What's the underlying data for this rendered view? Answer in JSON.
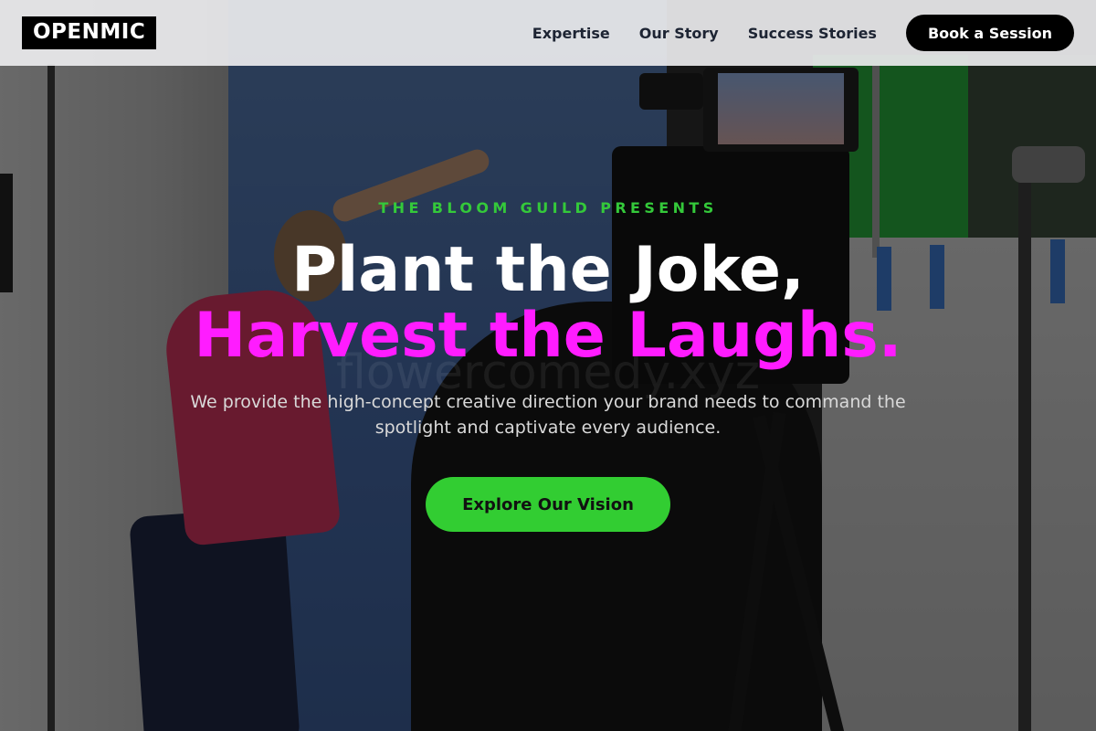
{
  "nav": {
    "logo": "OPENMIC",
    "links": [
      {
        "label": "Expertise"
      },
      {
        "label": "Our Story"
      },
      {
        "label": "Success Stories"
      }
    ],
    "cta": "Book a Session"
  },
  "hero": {
    "eyebrow": "THE BLOOM GUILD PRESENTS",
    "headline_line1": "Plant the Joke,",
    "headline_line2": "Harvest the Laughs.",
    "watermark": "flowercomedy.xyz",
    "subtext": "We provide the high-concept creative direction your brand needs to command the spotlight and captivate every audience.",
    "cta": "Explore Our Vision"
  },
  "colors": {
    "accent_green": "#32cd32",
    "accent_magenta": "#ff1cff",
    "nav_bg": "#ececee",
    "button_dark": "#000000"
  }
}
